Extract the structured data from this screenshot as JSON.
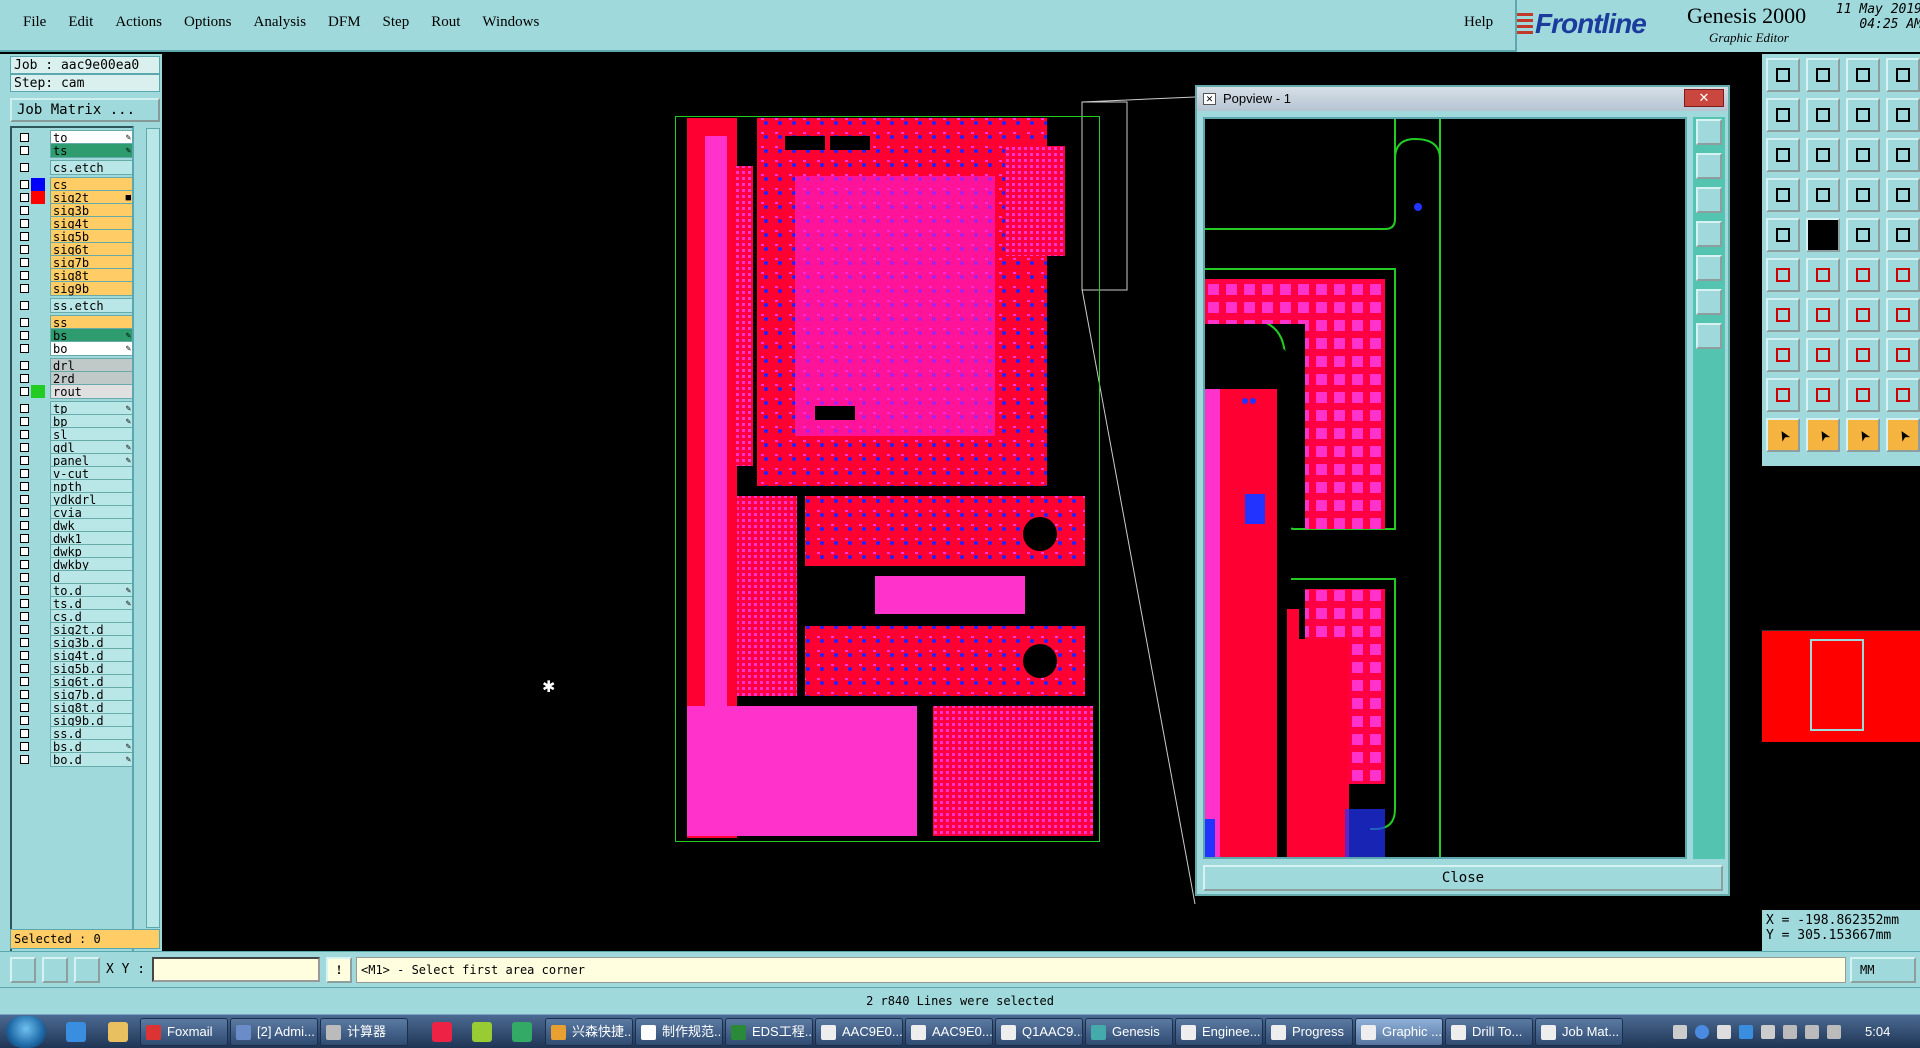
{
  "menubar": {
    "items": [
      "File",
      "Edit",
      "Actions",
      "Options",
      "Analysis",
      "DFM",
      "Step",
      "Rout",
      "Windows"
    ],
    "help": "Help"
  },
  "brand": {
    "logo": "Frontline",
    "product": "Genesis 2000",
    "subtitle": "Graphic Editor",
    "date": "11 May 2019",
    "time": "04:25 AM"
  },
  "job": {
    "job_label": "Job : aac9e00ea0",
    "step_label": "Step: cam",
    "matrix_button": "Job Matrix ..."
  },
  "layers": [
    {
      "name": "to",
      "bg": "#ffffff",
      "color": "",
      "flag": "✎"
    },
    {
      "name": "ts",
      "bg": "#2e9c6e",
      "color": "",
      "flag": "✎"
    },
    {
      "name": "cs.etch",
      "bg": "#b9e6e6",
      "color": "",
      "flag": ""
    },
    {
      "name": "cs",
      "bg": "#ffcc66",
      "color": "#0000ff",
      "flag": ""
    },
    {
      "name": "sig2t",
      "bg": "#ffcc66",
      "color": "#ff0000",
      "flag": "■"
    },
    {
      "name": "sig3b",
      "bg": "#ffcc66",
      "color": "",
      "flag": ""
    },
    {
      "name": "sig4t",
      "bg": "#ffcc66",
      "color": "",
      "flag": ""
    },
    {
      "name": "sig5b",
      "bg": "#ffcc66",
      "color": "",
      "flag": ""
    },
    {
      "name": "sig6t",
      "bg": "#ffcc66",
      "color": "",
      "flag": ""
    },
    {
      "name": "sig7b",
      "bg": "#ffcc66",
      "color": "",
      "flag": ""
    },
    {
      "name": "sig8t",
      "bg": "#ffcc66",
      "color": "",
      "flag": ""
    },
    {
      "name": "sig9b",
      "bg": "#ffcc66",
      "color": "",
      "flag": ""
    },
    {
      "name": "ss.etch",
      "bg": "#b9e6e6",
      "color": "",
      "flag": ""
    },
    {
      "name": "ss",
      "bg": "#ffcc66",
      "color": "",
      "flag": ""
    },
    {
      "name": "bs",
      "bg": "#2e9c6e",
      "color": "",
      "flag": "✎"
    },
    {
      "name": "bo",
      "bg": "#ffffff",
      "color": "",
      "flag": "✎"
    },
    {
      "name": "drl",
      "bg": "#c0c8c8",
      "color": "",
      "flag": ""
    },
    {
      "name": "2rd",
      "bg": "#c0c8c8",
      "color": "",
      "flag": ""
    },
    {
      "name": "rout",
      "bg": "#e0e0e0",
      "color": "#22cc22",
      "flag": ""
    },
    {
      "name": "tp",
      "bg": "#b9e6e6",
      "color": "",
      "flag": "✎"
    },
    {
      "name": "bp",
      "bg": "#b9e6e6",
      "color": "",
      "flag": "✎"
    },
    {
      "name": "sl",
      "bg": "#b9e6e6",
      "color": "",
      "flag": ""
    },
    {
      "name": "gdl",
      "bg": "#b9e6e6",
      "color": "",
      "flag": "✎"
    },
    {
      "name": "panel",
      "bg": "#b9e6e6",
      "color": "",
      "flag": "✎"
    },
    {
      "name": "v-cut",
      "bg": "#b9e6e6",
      "color": "",
      "flag": ""
    },
    {
      "name": "npth",
      "bg": "#b9e6e6",
      "color": "",
      "flag": ""
    },
    {
      "name": "ydkdrl",
      "bg": "#b9e6e6",
      "color": "",
      "flag": ""
    },
    {
      "name": "cvia",
      "bg": "#b9e6e6",
      "color": "",
      "flag": ""
    },
    {
      "name": "dwk",
      "bg": "#b9e6e6",
      "color": "",
      "flag": ""
    },
    {
      "name": "dwk1",
      "bg": "#b9e6e6",
      "color": "",
      "flag": ""
    },
    {
      "name": "dwkp",
      "bg": "#b9e6e6",
      "color": "",
      "flag": ""
    },
    {
      "name": "dwkby",
      "bg": "#b9e6e6",
      "color": "",
      "flag": ""
    },
    {
      "name": "d",
      "bg": "#b9e6e6",
      "color": "",
      "flag": ""
    },
    {
      "name": "to.d",
      "bg": "#b9e6e6",
      "color": "",
      "flag": "✎"
    },
    {
      "name": "ts.d",
      "bg": "#b9e6e6",
      "color": "",
      "flag": "✎"
    },
    {
      "name": "cs.d",
      "bg": "#b9e6e6",
      "color": "",
      "flag": ""
    },
    {
      "name": "sig2t.d",
      "bg": "#b9e6e6",
      "color": "",
      "flag": ""
    },
    {
      "name": "sig3b.d",
      "bg": "#b9e6e6",
      "color": "",
      "flag": ""
    },
    {
      "name": "sig4t.d",
      "bg": "#b9e6e6",
      "color": "",
      "flag": ""
    },
    {
      "name": "sig5b.d",
      "bg": "#b9e6e6",
      "color": "",
      "flag": ""
    },
    {
      "name": "sig6t.d",
      "bg": "#b9e6e6",
      "color": "",
      "flag": ""
    },
    {
      "name": "sig7b.d",
      "bg": "#b9e6e6",
      "color": "",
      "flag": ""
    },
    {
      "name": "sig8t.d",
      "bg": "#b9e6e6",
      "color": "",
      "flag": ""
    },
    {
      "name": "sig9b.d",
      "bg": "#b9e6e6",
      "color": "",
      "flag": ""
    },
    {
      "name": "ss.d",
      "bg": "#b9e6e6",
      "color": "",
      "flag": ""
    },
    {
      "name": "bs.d",
      "bg": "#b9e6e6",
      "color": "",
      "flag": "✎"
    },
    {
      "name": "bo.d",
      "bg": "#b9e6e6",
      "color": "",
      "flag": "✎"
    }
  ],
  "selected_label": "Selected : 0",
  "popview": {
    "title": "Popview - 1",
    "close_button": "Close"
  },
  "coords": {
    "x": "X = -198.862352mm",
    "y": "Y = 305.153667mm"
  },
  "command": {
    "xy_label": "X Y :",
    "xy_value": "",
    "info_button": "!",
    "prompt": "<M1> - Select first area corner",
    "units": "MM"
  },
  "status": "2 r840 Lines were selected",
  "taskbar": {
    "items": [
      {
        "label": "Foxmail",
        "color": "#d33"
      },
      {
        "label": "[2] Admi...",
        "color": "#6a8cc8"
      },
      {
        "label": "计算器",
        "color": "#bbb"
      },
      {
        "label": "兴森快捷...",
        "color": "#e8a030"
      },
      {
        "label": "制作规范...",
        "color": "#fff"
      },
      {
        "label": "EDS工程...",
        "color": "#2a8a3a"
      },
      {
        "label": "AAC9E0...",
        "color": "#eee"
      },
      {
        "label": "AAC9E0...",
        "color": "#eee"
      },
      {
        "label": "Q1AAC9...",
        "color": "#eee"
      },
      {
        "label": "Genesis",
        "color": "#4aa"
      },
      {
        "label": "Enginee...",
        "color": "#eee"
      },
      {
        "label": "Progress",
        "color": "#eee"
      },
      {
        "label": "Graphic ...",
        "color": "#eee"
      },
      {
        "label": "Drill To...",
        "color": "#eee"
      },
      {
        "label": "Job Mat...",
        "color": "#eee"
      }
    ],
    "active_index": 12,
    "clock": "5:04"
  }
}
